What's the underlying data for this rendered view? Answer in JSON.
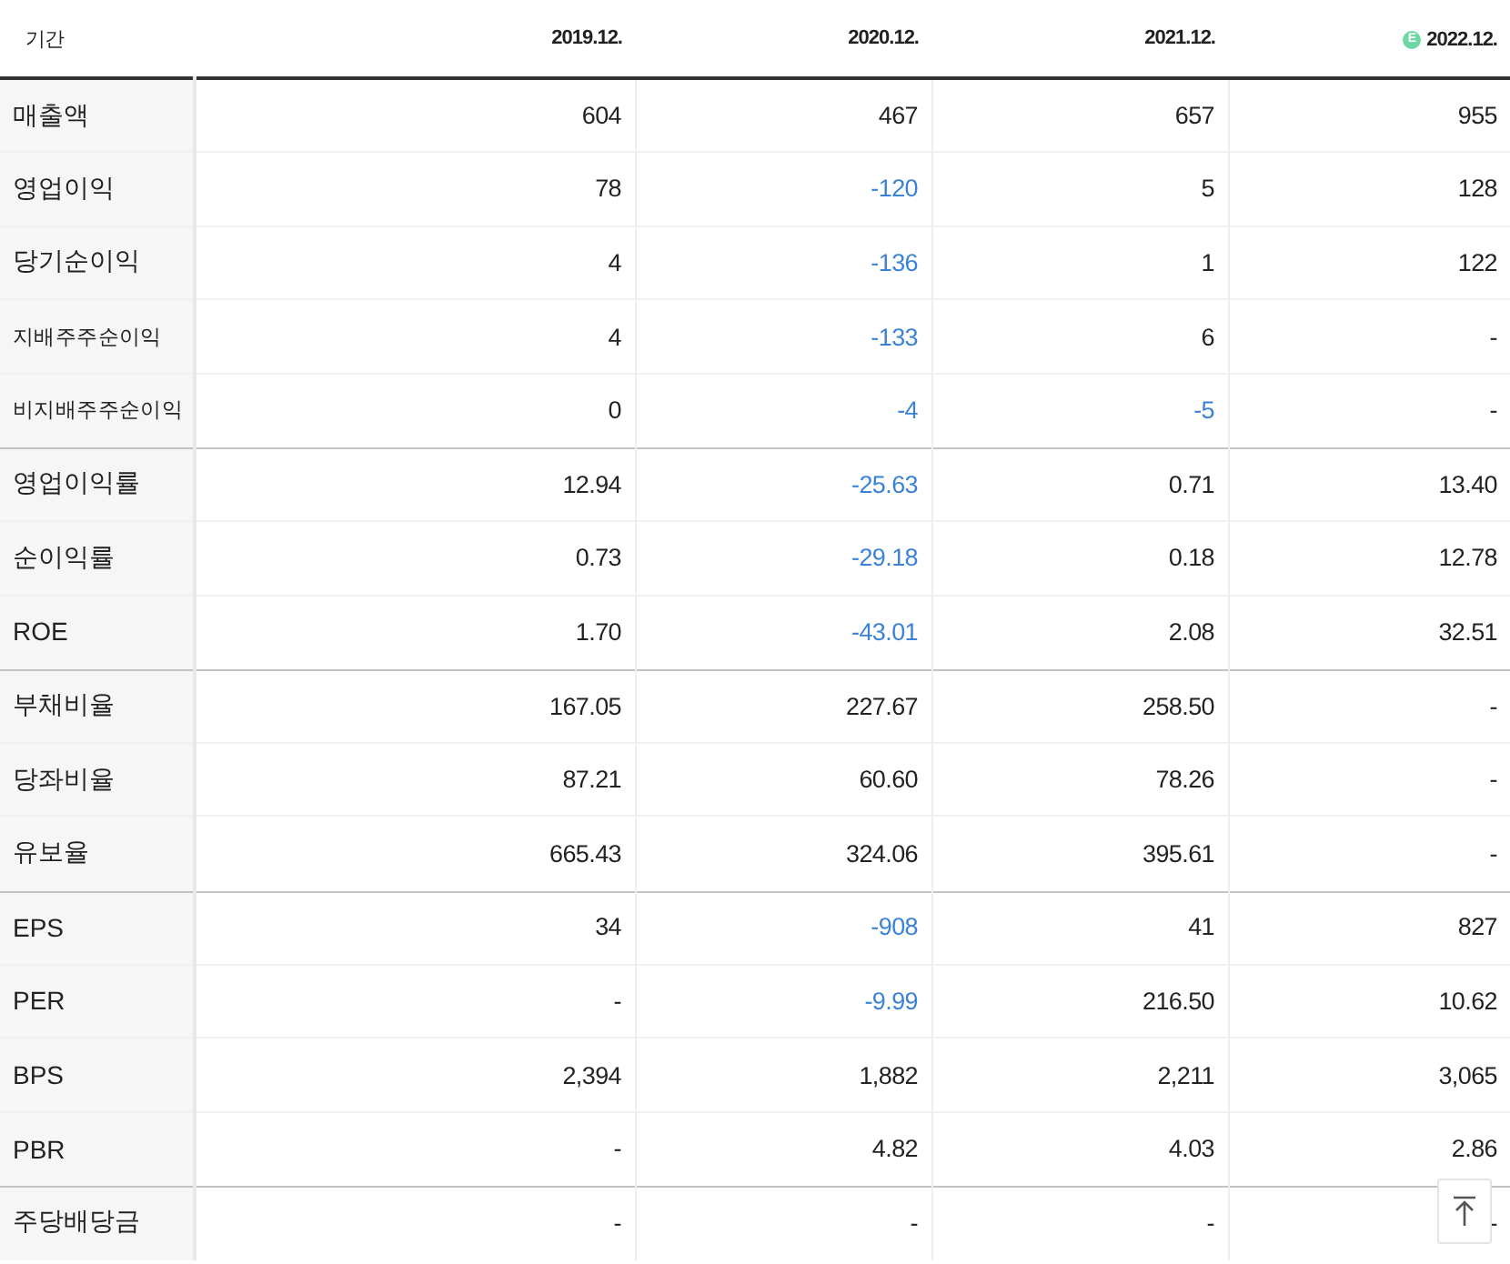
{
  "table": {
    "corner": "기간",
    "columns": [
      {
        "label": "2019.12."
      },
      {
        "label": "2020.12."
      },
      {
        "label": "2021.12."
      },
      {
        "label": "2022.12.",
        "estimate_mark": "E"
      }
    ],
    "rows": [
      {
        "label": "매출액",
        "kind": "main",
        "group_start": false,
        "cells": [
          {
            "text": "604",
            "negative": false
          },
          {
            "text": "467",
            "negative": false
          },
          {
            "text": "657",
            "negative": false
          },
          {
            "text": "955",
            "negative": false
          }
        ]
      },
      {
        "label": "영업이익",
        "kind": "main",
        "group_start": false,
        "cells": [
          {
            "text": "78",
            "negative": false
          },
          {
            "text": "-120",
            "negative": true
          },
          {
            "text": "5",
            "negative": false
          },
          {
            "text": "128",
            "negative": false
          }
        ]
      },
      {
        "label": "당기순이익",
        "kind": "main",
        "group_start": false,
        "cells": [
          {
            "text": "4",
            "negative": false
          },
          {
            "text": "-136",
            "negative": true
          },
          {
            "text": "1",
            "negative": false
          },
          {
            "text": "122",
            "negative": false
          }
        ]
      },
      {
        "label": "지배주주순이익",
        "kind": "sub",
        "group_start": false,
        "cells": [
          {
            "text": "4",
            "negative": false
          },
          {
            "text": "-133",
            "negative": true
          },
          {
            "text": "6",
            "negative": false
          },
          {
            "text": "-",
            "negative": false
          }
        ]
      },
      {
        "label": "비지배주주순이익",
        "kind": "sub",
        "group_start": false,
        "cells": [
          {
            "text": "0",
            "negative": false
          },
          {
            "text": "-4",
            "negative": true
          },
          {
            "text": "-5",
            "negative": true
          },
          {
            "text": "-",
            "negative": false
          }
        ]
      },
      {
        "label": "영업이익률",
        "kind": "main",
        "group_start": true,
        "cells": [
          {
            "text": "12.94",
            "negative": false
          },
          {
            "text": "-25.63",
            "negative": true
          },
          {
            "text": "0.71",
            "negative": false
          },
          {
            "text": "13.40",
            "negative": false
          }
        ]
      },
      {
        "label": "순이익률",
        "kind": "main",
        "group_start": false,
        "cells": [
          {
            "text": "0.73",
            "negative": false
          },
          {
            "text": "-29.18",
            "negative": true
          },
          {
            "text": "0.18",
            "negative": false
          },
          {
            "text": "12.78",
            "negative": false
          }
        ]
      },
      {
        "label": "ROE",
        "kind": "main",
        "group_start": false,
        "cells": [
          {
            "text": "1.70",
            "negative": false
          },
          {
            "text": "-43.01",
            "negative": true
          },
          {
            "text": "2.08",
            "negative": false
          },
          {
            "text": "32.51",
            "negative": false
          }
        ]
      },
      {
        "label": "부채비율",
        "kind": "main",
        "group_start": true,
        "cells": [
          {
            "text": "167.05",
            "negative": false
          },
          {
            "text": "227.67",
            "negative": false
          },
          {
            "text": "258.50",
            "negative": false
          },
          {
            "text": "-",
            "negative": false
          }
        ]
      },
      {
        "label": "당좌비율",
        "kind": "main",
        "group_start": false,
        "cells": [
          {
            "text": "87.21",
            "negative": false
          },
          {
            "text": "60.60",
            "negative": false
          },
          {
            "text": "78.26",
            "negative": false
          },
          {
            "text": "-",
            "negative": false
          }
        ]
      },
      {
        "label": "유보율",
        "kind": "main",
        "group_start": false,
        "cells": [
          {
            "text": "665.43",
            "negative": false
          },
          {
            "text": "324.06",
            "negative": false
          },
          {
            "text": "395.61",
            "negative": false
          },
          {
            "text": "-",
            "negative": false
          }
        ]
      },
      {
        "label": "EPS",
        "kind": "main",
        "group_start": true,
        "cells": [
          {
            "text": "34",
            "negative": false
          },
          {
            "text": "-908",
            "negative": true
          },
          {
            "text": "41",
            "negative": false
          },
          {
            "text": "827",
            "negative": false
          }
        ]
      },
      {
        "label": "PER",
        "kind": "main",
        "group_start": false,
        "cells": [
          {
            "text": "-",
            "negative": false
          },
          {
            "text": "-9.99",
            "negative": true
          },
          {
            "text": "216.50",
            "negative": false
          },
          {
            "text": "10.62",
            "negative": false
          }
        ]
      },
      {
        "label": "BPS",
        "kind": "main",
        "group_start": false,
        "cells": [
          {
            "text": "2,394",
            "negative": false
          },
          {
            "text": "1,882",
            "negative": false
          },
          {
            "text": "2,211",
            "negative": false
          },
          {
            "text": "3,065",
            "negative": false
          }
        ]
      },
      {
        "label": "PBR",
        "kind": "main",
        "group_start": false,
        "cells": [
          {
            "text": "-",
            "negative": false
          },
          {
            "text": "4.82",
            "negative": false
          },
          {
            "text": "4.03",
            "negative": false
          },
          {
            "text": "2.86",
            "negative": false
          }
        ]
      },
      {
        "label": "주당배당금",
        "kind": "main",
        "group_start": true,
        "cells": [
          {
            "text": "-",
            "negative": false
          },
          {
            "text": "-",
            "negative": false
          },
          {
            "text": "-",
            "negative": false
          },
          {
            "text": "-",
            "negative": false
          }
        ]
      }
    ]
  }
}
